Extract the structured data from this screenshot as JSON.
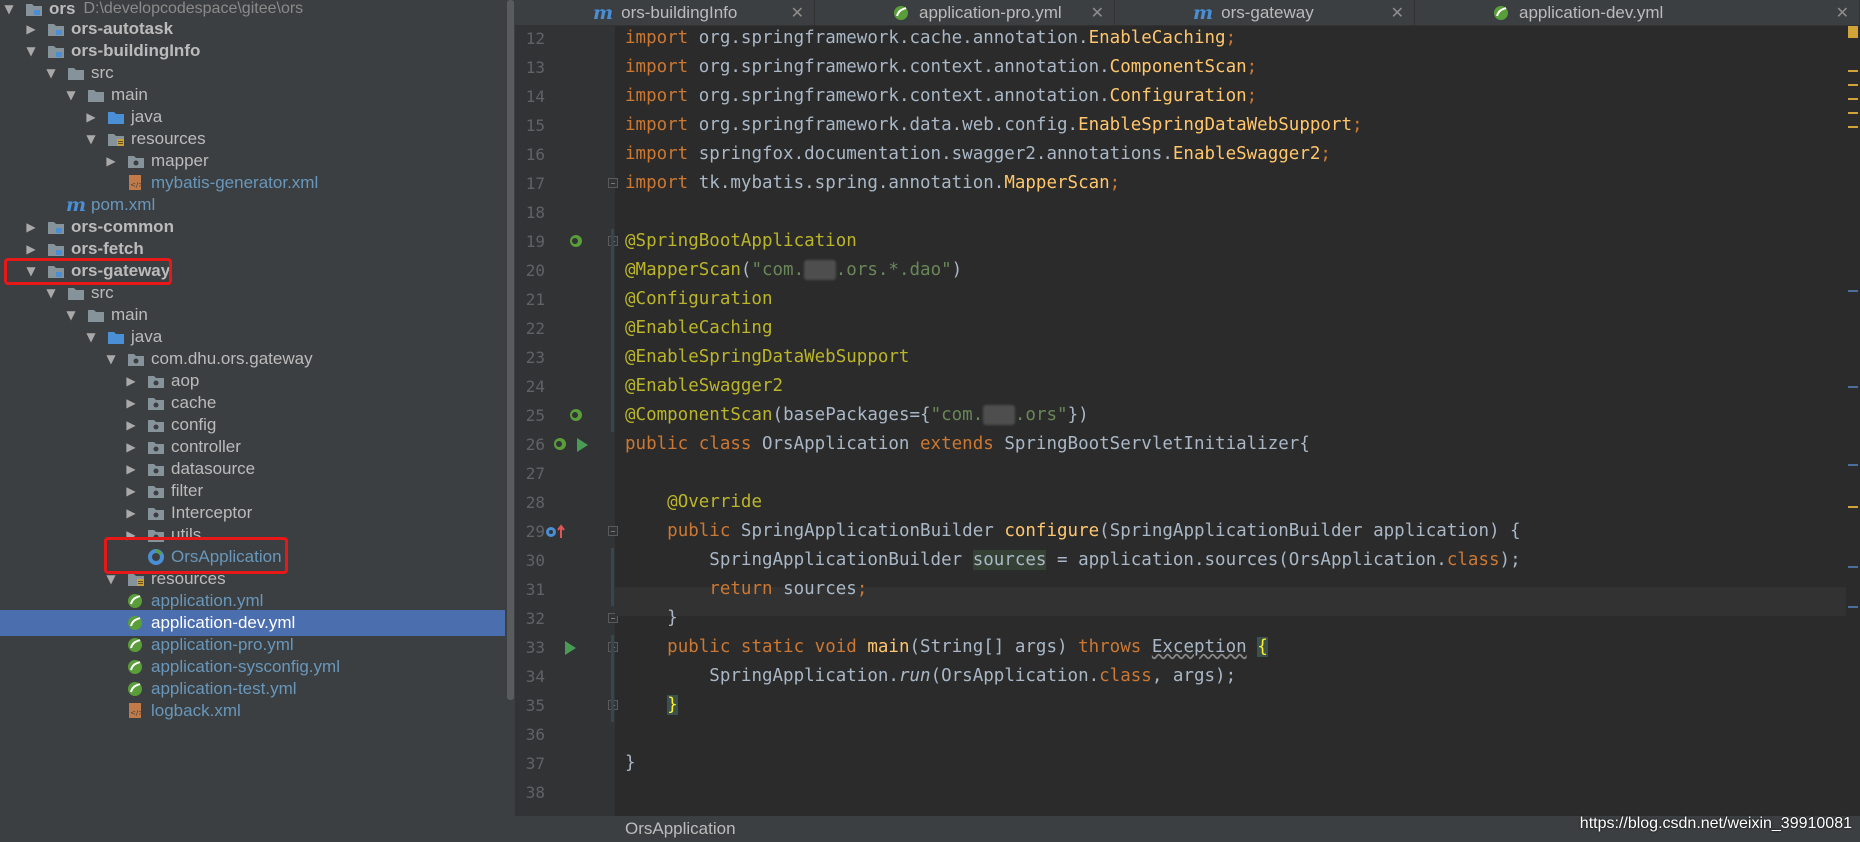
{
  "tree": {
    "root_name": "ors",
    "root_path": "D:\\developcodespace\\gitee\\ors",
    "items": [
      {
        "label": "ors-autotask",
        "kind": "module",
        "arrow": "right"
      },
      {
        "label": "ors-buildingInfo",
        "kind": "module",
        "arrow": "down"
      },
      {
        "label": "src",
        "kind": "folder",
        "arrow": "down"
      },
      {
        "label": "main",
        "kind": "folder",
        "arrow": "down"
      },
      {
        "label": "java",
        "kind": "source-folder",
        "arrow": "right"
      },
      {
        "label": "resources",
        "kind": "resources-folder",
        "arrow": "down"
      },
      {
        "label": "mapper",
        "kind": "package",
        "arrow": "right"
      },
      {
        "label": "mybatis-generator.xml",
        "kind": "xml-file",
        "arrow": ""
      },
      {
        "label": "pom.xml",
        "kind": "maven-file",
        "arrow": ""
      },
      {
        "label": "ors-common",
        "kind": "module",
        "arrow": "right"
      },
      {
        "label": "ors-fetch",
        "kind": "module",
        "arrow": "right"
      },
      {
        "label": "ors-gateway",
        "kind": "module",
        "arrow": "down"
      },
      {
        "label": "src",
        "kind": "folder",
        "arrow": "down"
      },
      {
        "label": "main",
        "kind": "folder",
        "arrow": "down"
      },
      {
        "label": "java",
        "kind": "source-folder",
        "arrow": "down"
      },
      {
        "label": "com.dhu.ors.gateway",
        "kind": "package",
        "arrow": "down"
      },
      {
        "label": "aop",
        "kind": "package",
        "arrow": "right"
      },
      {
        "label": "cache",
        "kind": "package",
        "arrow": "right"
      },
      {
        "label": "config",
        "kind": "package",
        "arrow": "right"
      },
      {
        "label": "controller",
        "kind": "package",
        "arrow": "right"
      },
      {
        "label": "datasource",
        "kind": "package",
        "arrow": "right"
      },
      {
        "label": "filter",
        "kind": "package",
        "arrow": "right"
      },
      {
        "label": "Interceptor",
        "kind": "package",
        "arrow": "right"
      },
      {
        "label": "utils",
        "kind": "package",
        "arrow": "right"
      },
      {
        "label": "OrsApplication",
        "kind": "spring-class",
        "arrow": ""
      },
      {
        "label": "resources",
        "kind": "resources-folder",
        "arrow": "down"
      },
      {
        "label": "application.yml",
        "kind": "yml-file",
        "arrow": ""
      },
      {
        "label": "application-dev.yml",
        "kind": "yml-file",
        "arrow": ""
      },
      {
        "label": "application-pro.yml",
        "kind": "yml-file",
        "arrow": ""
      },
      {
        "label": "application-sysconfig.yml",
        "kind": "yml-file",
        "arrow": ""
      },
      {
        "label": "application-test.yml",
        "kind": "yml-file",
        "arrow": ""
      },
      {
        "label": "logback.xml",
        "kind": "xml-file",
        "arrow": ""
      }
    ]
  },
  "tabs": [
    {
      "label": "ors-buildingInfo",
      "icon": "maven-icon"
    },
    {
      "label": "application-pro.yml",
      "icon": "spring-yml-icon"
    },
    {
      "label": "ors-gateway",
      "icon": "maven-icon"
    },
    {
      "label": "application-dev.yml",
      "icon": "spring-yml-icon"
    }
  ],
  "editor": {
    "line_numbers": [
      "12",
      "13",
      "14",
      "15",
      "16",
      "17",
      "18",
      "19",
      "20",
      "21",
      "22",
      "23",
      "24",
      "25",
      "26",
      "27",
      "28",
      "29",
      "30",
      "31",
      "32",
      "33",
      "34",
      "35",
      "36",
      "37",
      "38"
    ],
    "code": {
      "l12": [
        "import ",
        "org.springframework.cache.annotation.",
        "EnableCaching",
        ";"
      ],
      "l13": [
        "import ",
        "org.springframework.context.annotation.",
        "ComponentScan",
        ";"
      ],
      "l14": [
        "import ",
        "org.springframework.context.annotation.",
        "Configuration",
        ";"
      ],
      "l15": [
        "import ",
        "org.springframework.data.web.config.",
        "EnableSpringDataWebSupport",
        ";"
      ],
      "l16": [
        "import ",
        "springfox.documentation.swagger2.annotations.",
        "EnableSwagger2",
        ";"
      ],
      "l17": [
        "import ",
        "tk.mybatis.spring.annotation.",
        "MapperScan",
        ";"
      ],
      "l19": "@SpringBootApplication",
      "l20_ann": "@MapperScan",
      "l20_str_a": "\"com.",
      "l20_str_b": ".ors.*.dao\"",
      "l21": "@Configuration",
      "l22": "@EnableCaching",
      "l23": "@EnableSpringDataWebSupport",
      "l24": "@EnableSwagger2",
      "l25_ann": "@ComponentScan",
      "l25_param": "basePackages",
      "l25_str_a": "\"com.",
      "l25_str_b": ".ors\"",
      "l26_kw1": "public class ",
      "l26_name": "OrsApplication ",
      "l26_kw2": "extends ",
      "l26_rest": "SpringBootServletInitializer{",
      "l28": "@Override",
      "l29_kw": "public ",
      "l29_type": "SpringApplicationBuilder ",
      "l29_meth": "configure",
      "l29_rest": "(SpringApplicationBuilder application) {",
      "l30_type": "SpringApplicationBuilder ",
      "l30_var": "sources",
      "l30_rest": " = application.sources(OrsApplication.",
      "l30_kw": "class",
      "l30_end": ");",
      "l31_kw": "return ",
      "l31_rest": "sources",
      "l31_end": ";",
      "l32": "}",
      "l33_kw": "public static void ",
      "l33_meth": "main",
      "l33_rest": "(String[] args) ",
      "l33_throws": "throws ",
      "l33_exc": "Exception",
      "l33_brace": "{",
      "l34_a": "SpringApplication.",
      "l34_meth": "run",
      "l34_b": "(OrsApplication.",
      "l34_kw": "class",
      "l34_c": ", args);",
      "l35": "}",
      "l37": "}"
    }
  },
  "status": {
    "file_name": "OrsApplication",
    "watermark": "https://blog.csdn.net/weixin_39910081"
  },
  "colors": {
    "selection": "#4b6eaf",
    "highlight_box": "#e81818",
    "keyword": "#cc7832",
    "annotation": "#bbb529",
    "string": "#6a8759"
  }
}
